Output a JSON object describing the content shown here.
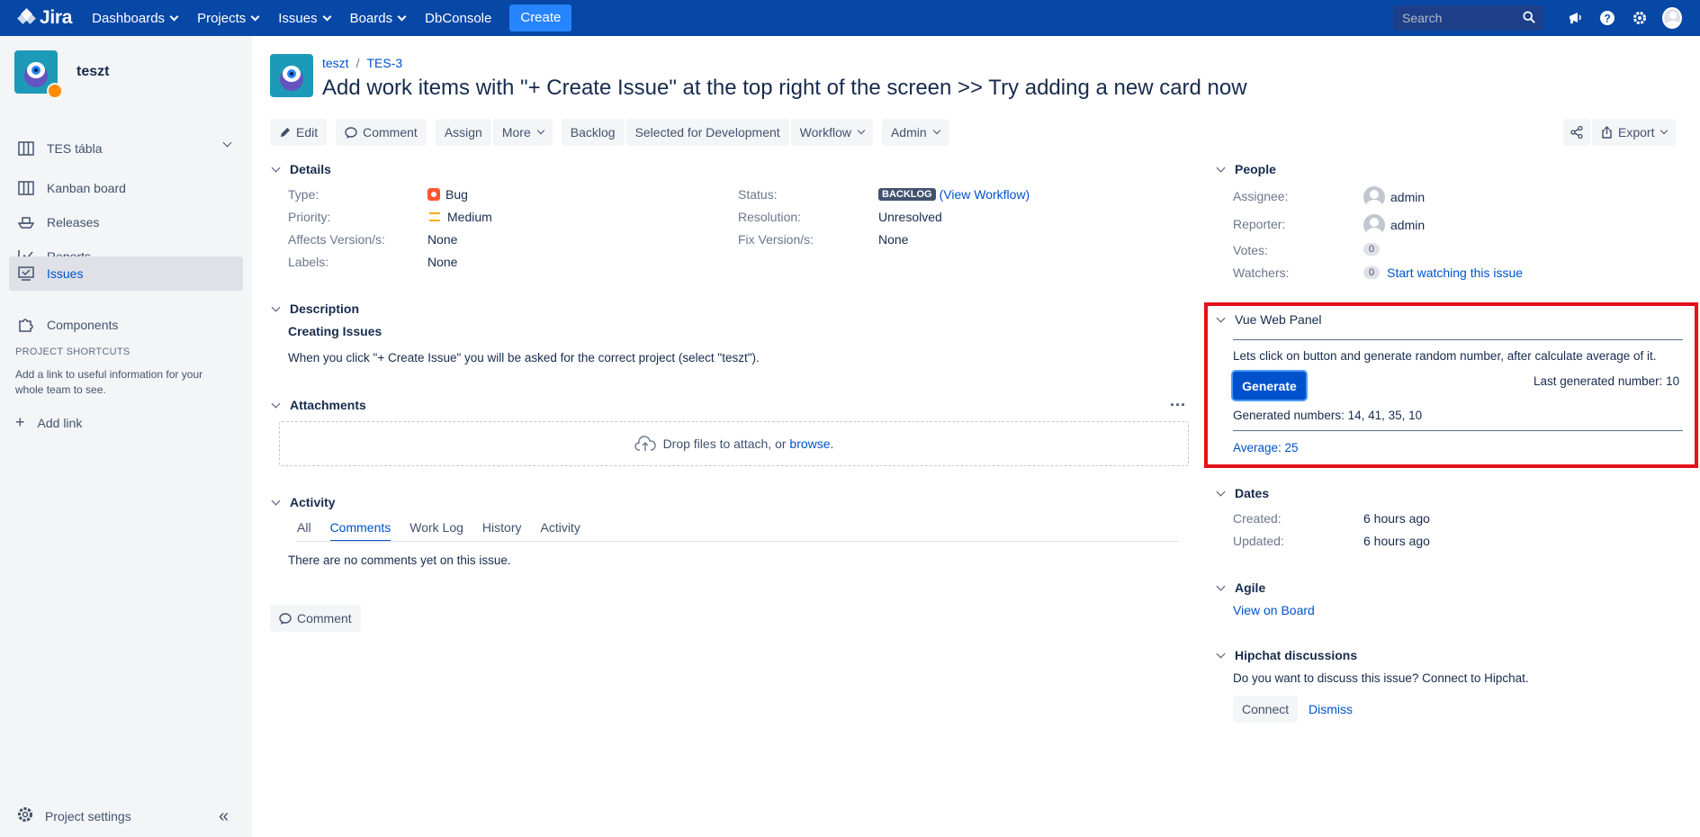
{
  "topnav": {
    "logo": "Jira",
    "items": [
      "Dashboards",
      "Projects",
      "Issues",
      "Boards"
    ],
    "dbconsole": "DbConsole",
    "create": "Create",
    "search_placeholder": "Search"
  },
  "sidebar": {
    "project_name": "teszt",
    "board": "TES tábla",
    "items": [
      "Kanban board",
      "Releases",
      "Reports",
      "Issues",
      "Components"
    ],
    "shortcuts_title": "PROJECT SHORTCUTS",
    "shortcuts_text": "Add a link to useful information for your whole team to see.",
    "add_link": "Add link",
    "settings": "Project settings"
  },
  "issue": {
    "project_crumb": "teszt",
    "key": "TES-3",
    "title": "Add work items with \"+ Create Issue\" at the top right of the screen >> Try adding a new card now"
  },
  "toolbar": {
    "edit": "Edit",
    "comment": "Comment",
    "assign": "Assign",
    "more": "More",
    "backlog": "Backlog",
    "selected": "Selected for Development",
    "workflow": "Workflow",
    "admin": "Admin",
    "export": "Export"
  },
  "details": {
    "heading": "Details",
    "type_label": "Type:",
    "type_value": "Bug",
    "priority_label": "Priority:",
    "priority_value": "Medium",
    "affects_label": "Affects Version/s:",
    "affects_value": "None",
    "labels_label": "Labels:",
    "labels_value": "None",
    "status_label": "Status:",
    "status_value": "BACKLOG",
    "view_workflow": "(View Workflow)",
    "resolution_label": "Resolution:",
    "resolution_value": "Unresolved",
    "fix_label": "Fix Version/s:",
    "fix_value": "None"
  },
  "description": {
    "heading": "Description",
    "subheading": "Creating Issues",
    "text": "When you click \"+ Create Issue\" you will be asked for the correct project (select \"teszt\")."
  },
  "attachments": {
    "heading": "Attachments",
    "drop_text": "Drop files to attach, or",
    "browse": "browse."
  },
  "activity": {
    "heading": "Activity",
    "tabs": [
      "All",
      "Comments",
      "Work Log",
      "History",
      "Activity"
    ],
    "empty": "There are no comments yet on this issue.",
    "comment_button": "Comment"
  },
  "people": {
    "heading": "People",
    "assignee_label": "Assignee:",
    "assignee": "admin",
    "reporter_label": "Reporter:",
    "reporter": "admin",
    "votes_label": "Votes:",
    "votes": "0",
    "watchers_label": "Watchers:",
    "watchers": "0",
    "watch_link": "Start watching this issue"
  },
  "vue_panel": {
    "heading": "Vue Web Panel",
    "intro": "Lets click on button and generate random number, after calculate average of it.",
    "generate": "Generate",
    "last_generated": "Last generated number: 10",
    "generated_numbers": "Generated numbers: 14, 41, 35, 10",
    "average": "Average: 25"
  },
  "dates": {
    "heading": "Dates",
    "created_label": "Created:",
    "created": "6 hours ago",
    "updated_label": "Updated:",
    "updated": "6 hours ago"
  },
  "agile": {
    "heading": "Agile",
    "link": "View on Board"
  },
  "hipchat": {
    "heading": "Hipchat discussions",
    "text": "Do you want to discuss this issue? Connect to Hipchat.",
    "connect": "Connect",
    "dismiss": "Dismiss"
  },
  "colors": {
    "nav": "#0747a6",
    "accent": "#0052cc",
    "highlight_box": "#e3101a"
  }
}
